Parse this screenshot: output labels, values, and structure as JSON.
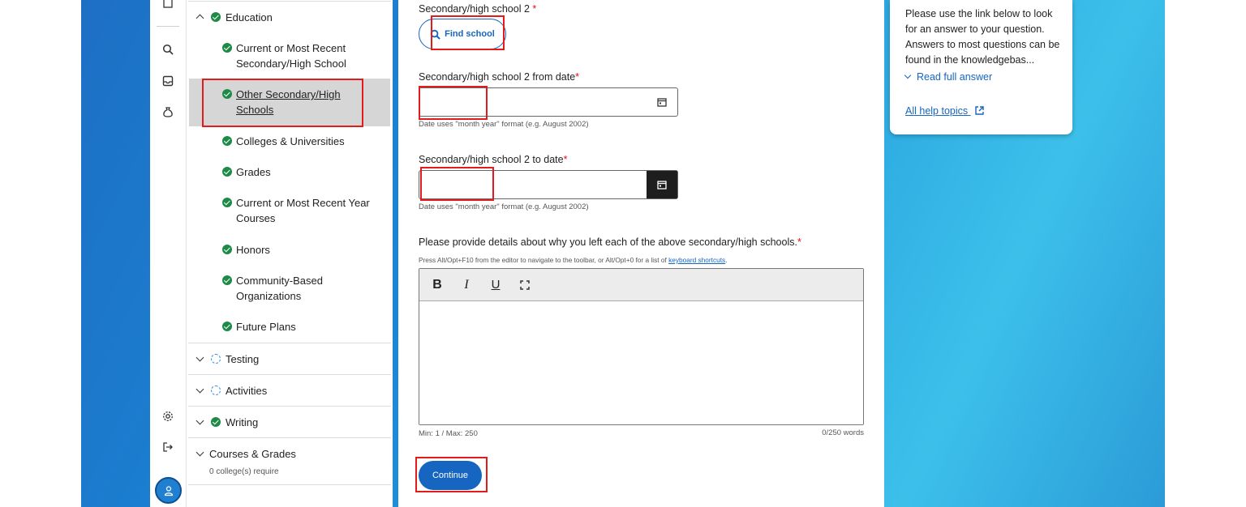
{
  "nav": {
    "education": {
      "label": "Education",
      "items": [
        "Current or Most Recent Secondary/High School",
        "Other Secondary/High Schools",
        "Colleges & Universities",
        "Grades",
        "Current or Most Recent Year Courses",
        "Honors",
        "Community-Based Organizations",
        "Future Plans"
      ],
      "active_index": 1
    },
    "sections": [
      {
        "label": "Testing",
        "status": "in-progress"
      },
      {
        "label": "Activities",
        "status": "in-progress"
      },
      {
        "label": "Writing",
        "status": "complete"
      },
      {
        "label": "Courses & Grades",
        "status": "none",
        "sublabel": "0 college(s) require"
      }
    ]
  },
  "form": {
    "school_label": "Secondary/high school 2",
    "find_school": "Find school",
    "from_label": "Secondary/high school 2 from date",
    "to_label": "Secondary/high school 2 to date",
    "date_hint": "Date uses \"month year\" format (e.g. August 2002)",
    "required_mark": "*",
    "details_label": "Please provide details about why you left each of the above secondary/high schools.",
    "editor_hint_prefix": "Press Alt/Opt+F10 from the editor to navigate to the toolbar, or Alt/Opt+0 for a list of ",
    "editor_hint_link": "keyboard shortcuts",
    "editor_hint_suffix": ".",
    "toolbar": {
      "bold": "B",
      "italic": "I",
      "underline": "U"
    },
    "min_max": "Min: 1 / Max: 250",
    "word_count": "0/250 words",
    "continue": "Continue"
  },
  "help": {
    "text": "Please use the link below to look for an answer to your question. Answers to most questions can be found in the knowledgebas...",
    "read_more": "Read full answer",
    "all_topics": "All help topics"
  },
  "colors": {
    "accent": "#1665c1",
    "complete": "#1e8a47",
    "highlight": "#e51b1b"
  }
}
